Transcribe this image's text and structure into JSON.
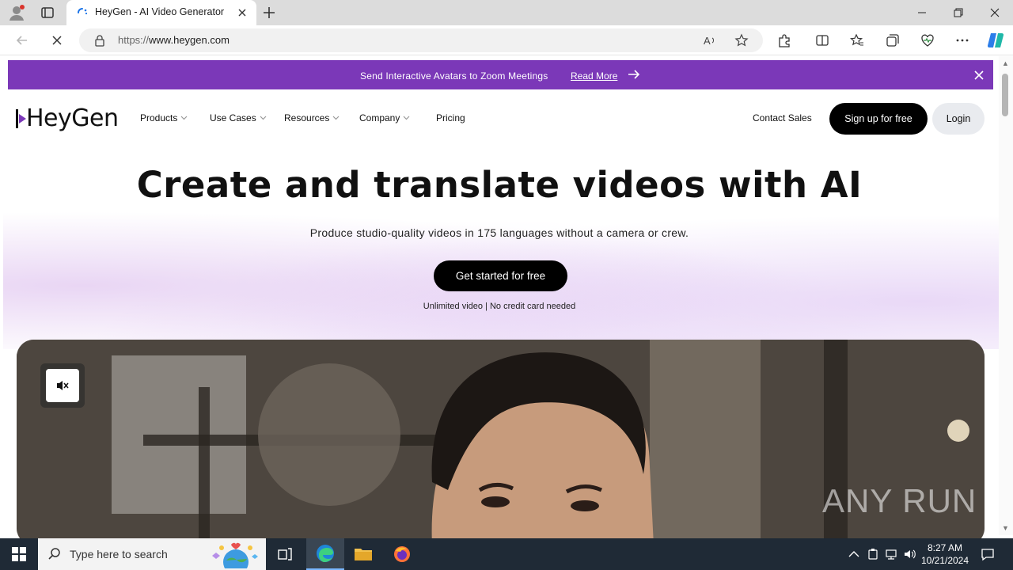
{
  "browser": {
    "tab_title": "HeyGen - AI Video Generator",
    "url_scheme": "https://",
    "url_host": "www.heygen.com"
  },
  "banner": {
    "text": "Send Interactive Avatars to Zoom Meetings",
    "link": "Read More"
  },
  "site": {
    "logo": "HeyGen",
    "nav": [
      {
        "label": "Products"
      },
      {
        "label": "Use Cases"
      },
      {
        "label": "Resources"
      },
      {
        "label": "Company"
      },
      {
        "label": "Pricing"
      }
    ],
    "contact": "Contact Sales",
    "signup": "Sign up for free",
    "login": "Login"
  },
  "hero": {
    "title": "Create and translate videos with AI",
    "subtitle": "Produce studio-quality videos in 175 languages without a camera or crew.",
    "cta": "Get started for free",
    "note": "Unlimited video | No credit card needed"
  },
  "video": {
    "watermark": "ANY RUN"
  },
  "taskbar": {
    "search_placeholder": "Type here to search",
    "time": "8:27 AM",
    "date": "10/21/2024"
  },
  "colors": {
    "banner": "#7b38b8",
    "cta": "#000000",
    "taskbar": "#1f2a36"
  }
}
